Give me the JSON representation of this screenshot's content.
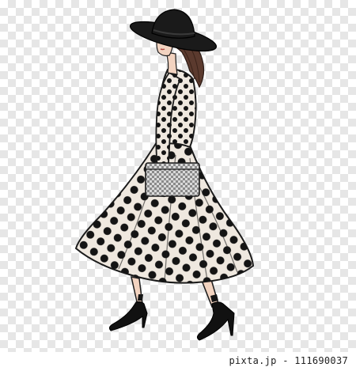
{
  "image": {
    "subject": "fashion-illustration-woman-polka-dot-dress",
    "background": "transparency-checkerboard",
    "colors": {
      "checker_light": "#ffffff",
      "checker_dark": "#e6e6e6",
      "dress": "#efe8df",
      "dots": "#141414",
      "hat": "#1a1a1a",
      "hair": "#5b3a2e",
      "skin": "#f2d3c0",
      "outline": "#1b1b1b"
    }
  },
  "watermark": {
    "stock_text": "pixta.jp - 111690037"
  }
}
